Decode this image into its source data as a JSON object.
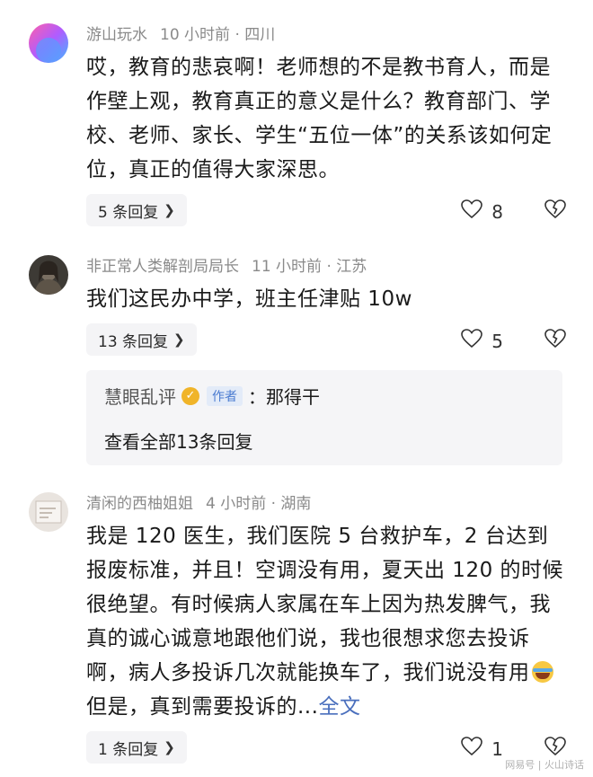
{
  "comments": [
    {
      "author": "游山玩水",
      "time_location": "10 小时前 · 四川",
      "text": "哎，教育的悲哀啊！老师想的不是教书育人，而是作壁上观，教育真正的意义是什么？教育部门、学校、老师、家长、学生“五位一体”的关系该如何定位，真正的值得大家深思。",
      "reply_label": "5 条回复",
      "likes": "8"
    },
    {
      "author": "非正常人类解剖局局长",
      "time_location": "11 小时前 · 江苏",
      "text": "我们这民办中学，班主任津贴 10w",
      "reply_label": "13 条回复",
      "likes": "5",
      "sub_reply": {
        "author": "慧眼乱评",
        "tag": "作者",
        "text": "：那得干",
        "view_all": "查看全部13条回复"
      }
    },
    {
      "author": "清闲的西柚姐姐",
      "time_location": "4 小时前 · 湖南",
      "text_before_emoji": "我是 120 医生，我们医院 5 台救护车，2 台达到报废标准，并且！空调没有用，夏天出 120 的时候很绝望。有时候病人家属在车上因为热发脾气，我真的诚心诚意地跟他们说，我也很想求您去投诉啊，病人多投诉几次就能换车了，我们说没有用",
      "text_after_emoji": "但是，真到需要投诉的...",
      "full_text_link": "全文",
      "reply_label": "1 条回复",
      "likes": "1"
    }
  ],
  "watermark": "网易号 | 火山诗话",
  "colors": {
    "accent_link": "#4a6fbd",
    "meta_gray": "#8a8a8a",
    "reply_bg": "#f4f4f6",
    "author_tag": "#4a7bd0",
    "verified": "#f0b429"
  }
}
